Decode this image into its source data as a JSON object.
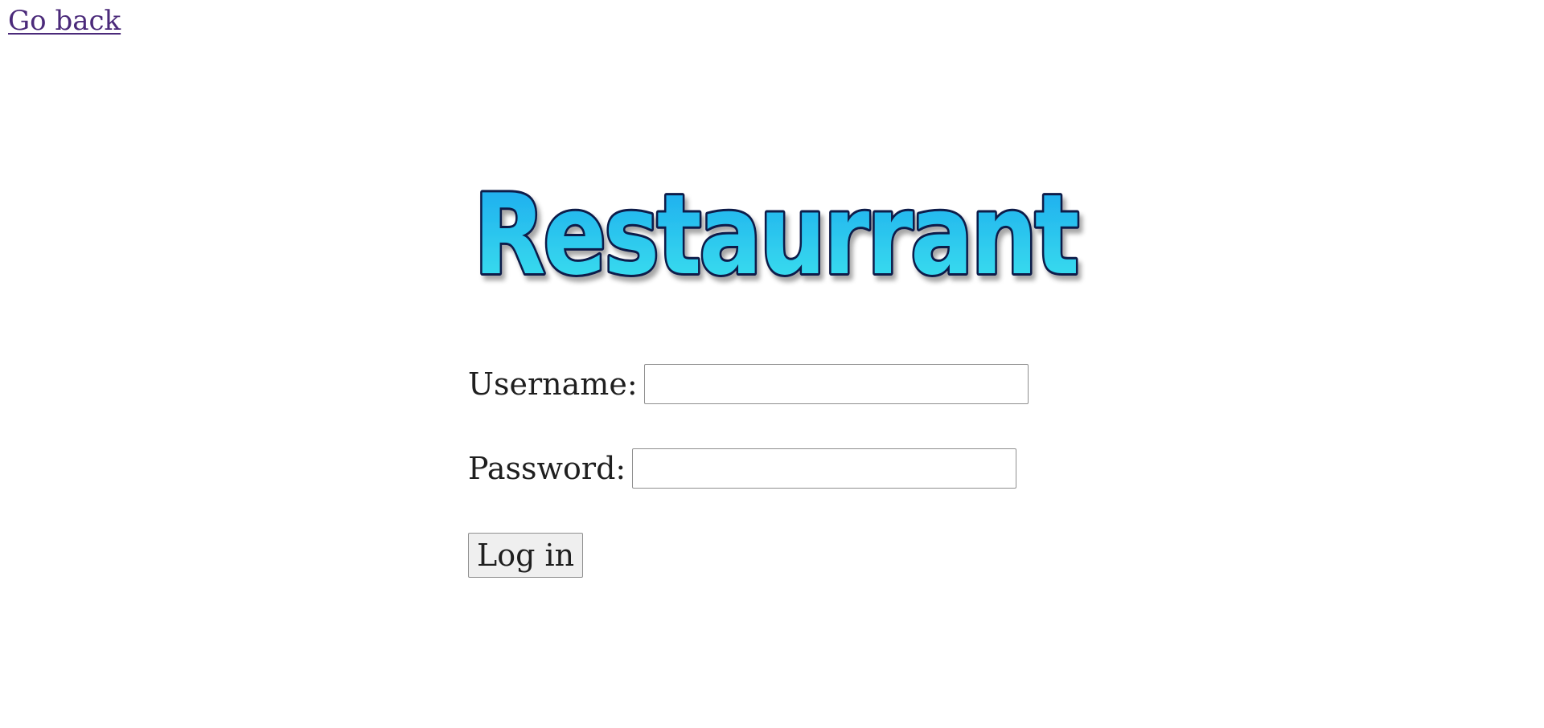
{
  "nav": {
    "back_label": "Go back"
  },
  "logo": {
    "text": "Restaurrant",
    "icon": "restaurrant-logo"
  },
  "form": {
    "username_label": "Username:",
    "username_value": "",
    "password_label": "Password:",
    "password_value": "",
    "submit_label": "Log in"
  },
  "colors": {
    "link": "#4b2a7a",
    "logo_top": "#1aa6ef",
    "logo_bottom": "#3ee6ee",
    "logo_outline": "#0f1a4a",
    "button_bg": "#efefef",
    "input_border": "#8f8f8f"
  }
}
